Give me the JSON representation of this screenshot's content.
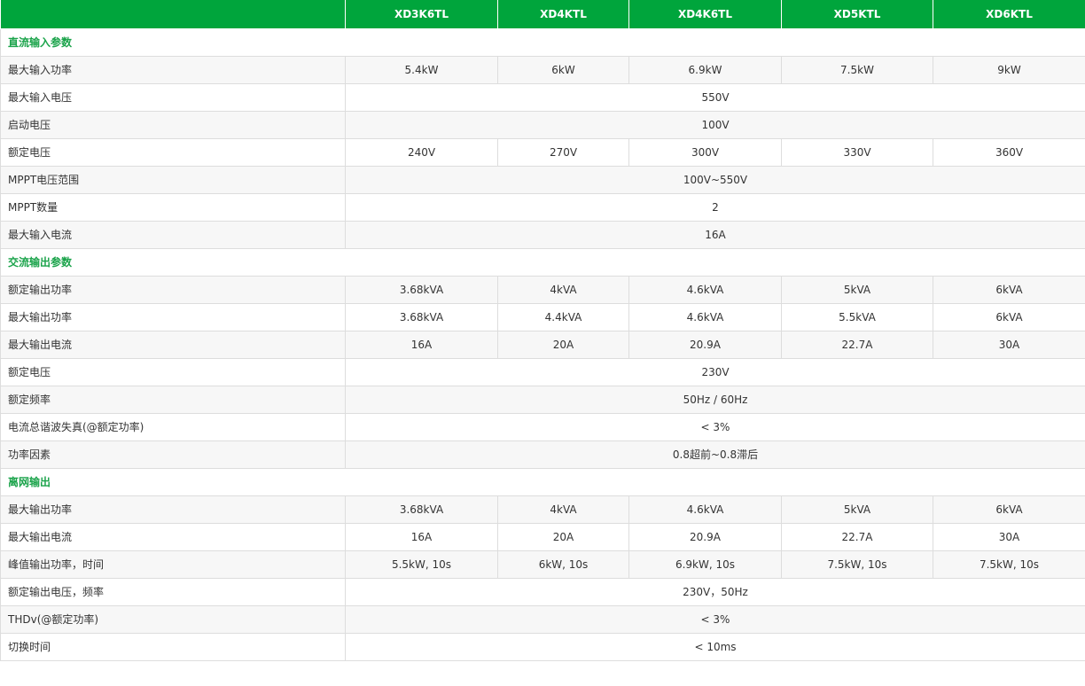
{
  "models": [
    "XD3K6TL",
    "XD4KTL",
    "XD4K6TL",
    "XD5KTL",
    "XD6KTL"
  ],
  "colors": {
    "header_bg": "#00a53c",
    "section_text": "#1aa34a",
    "row_alt": "#f7f7f7",
    "border": "#dddddd"
  },
  "rows": [
    {
      "kind": "section",
      "label": "直流输入参数"
    },
    {
      "kind": "row",
      "label": "最大输入功率",
      "values": [
        "5.4kW",
        "6kW",
        "6.9kW",
        "7.5kW",
        "9kW"
      ]
    },
    {
      "kind": "row",
      "label": "最大输入电压",
      "merged": "550V"
    },
    {
      "kind": "row",
      "label": "启动电压",
      "merged": "100V"
    },
    {
      "kind": "row",
      "label": "额定电压",
      "values": [
        "240V",
        "270V",
        "300V",
        "330V",
        "360V"
      ]
    },
    {
      "kind": "row",
      "label": "MPPT电压范围",
      "merged": "100V~550V"
    },
    {
      "kind": "row",
      "label": "MPPT数量",
      "merged": "2"
    },
    {
      "kind": "row",
      "label": "最大输入电流",
      "merged": "16A"
    },
    {
      "kind": "section",
      "label": "交流输出参数"
    },
    {
      "kind": "row",
      "label": "额定输出功率",
      "values": [
        "3.68kVA",
        "4kVA",
        "4.6kVA",
        "5kVA",
        "6kVA"
      ]
    },
    {
      "kind": "row",
      "label": "最大输出功率",
      "values": [
        "3.68kVA",
        "4.4kVA",
        "4.6kVA",
        "5.5kVA",
        "6kVA"
      ]
    },
    {
      "kind": "row",
      "label": "最大输出电流",
      "values": [
        "16A",
        "20A",
        "20.9A",
        "22.7A",
        "30A"
      ]
    },
    {
      "kind": "row",
      "label": "额定电压",
      "merged": "230V"
    },
    {
      "kind": "row",
      "label": "额定频率",
      "merged": "50Hz / 60Hz"
    },
    {
      "kind": "row",
      "label": "电流总谐波失真(@额定功率)",
      "merged": "< 3%"
    },
    {
      "kind": "row",
      "label": "功率因素",
      "merged": "0.8超前~0.8滞后"
    },
    {
      "kind": "section",
      "label": "离网输出"
    },
    {
      "kind": "row",
      "label": "最大输出功率",
      "values": [
        "3.68kVA",
        "4kVA",
        "4.6kVA",
        "5kVA",
        "6kVA"
      ]
    },
    {
      "kind": "row",
      "label": "最大输出电流",
      "values": [
        "16A",
        "20A",
        "20.9A",
        "22.7A",
        "30A"
      ]
    },
    {
      "kind": "row",
      "label": "峰值输出功率，时间",
      "values": [
        "5.5kW, 10s",
        "6kW, 10s",
        "6.9kW, 10s",
        "7.5kW, 10s",
        "7.5kW, 10s"
      ]
    },
    {
      "kind": "row",
      "label": "额定输出电压，频率",
      "merged": "230V，50Hz"
    },
    {
      "kind": "row",
      "label": "THDv(@额定功率)",
      "merged": "< 3%"
    },
    {
      "kind": "row",
      "label": "切换时间",
      "merged": "< 10ms"
    }
  ]
}
